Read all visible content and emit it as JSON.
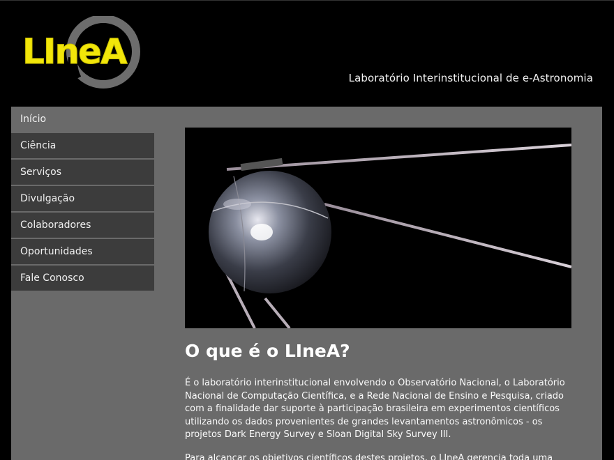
{
  "header": {
    "logo_text": "LIneA",
    "tagline": "Laboratório Interinstitucional de e-Astronomia"
  },
  "nav": {
    "items": [
      {
        "label": "Início"
      },
      {
        "label": "Ciência"
      },
      {
        "label": "Serviços"
      },
      {
        "label": "Divulgação"
      },
      {
        "label": "Colaboradores"
      },
      {
        "label": "Oportunidades"
      },
      {
        "label": "Fale Conosco"
      }
    ]
  },
  "main": {
    "title": "O que é o LIneA?",
    "paragraphs": [
      "É o laboratório interinstitucional envolvendo o Observatório Nacional, o Laboratório Nacional de Computação Científica, e a Rede Nacional de Ensino e Pesquisa, criado com a finalidade dar suporte à participação brasileira em experimentos científicos utilizando os dados provenientes de grandes levantamentos astronômicos - os projetos Dark Energy Survey e Sloan Digital Sky Survey III.",
      "Para alcançar os objetivos científicos destes projetos, o LIneA gerencia toda uma"
    ]
  },
  "colors": {
    "background": "#000000",
    "panel": "#6a6a6a",
    "nav_item": "#3c3c3c",
    "logo_yellow": "#f2e60a",
    "logo_swirl": "#6d6d6d"
  }
}
